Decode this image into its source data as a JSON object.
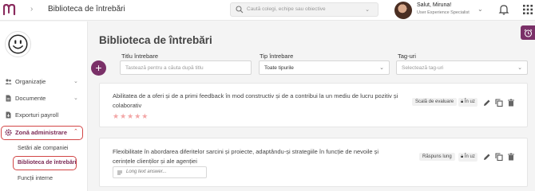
{
  "header": {
    "app_title": "Biblioteca de întrebări",
    "search_placeholder": "Caută colegi, echipe sau obiective",
    "user_name": "Salut, Miruna!",
    "user_role": "User Experience Specialist"
  },
  "sidebar": {
    "items": [
      {
        "label": "Organizație",
        "icon": "people-icon"
      },
      {
        "label": "Documente",
        "icon": "document-icon"
      },
      {
        "label": "Exporturi payroll",
        "icon": "export-icon"
      },
      {
        "label": "Zonă administrare",
        "icon": "gear-icon"
      }
    ],
    "subitems": [
      {
        "label": "Setări ale companiei"
      },
      {
        "label": "Biblioteca de întrebări"
      },
      {
        "label": "Funcții interne"
      }
    ]
  },
  "main": {
    "title": "Biblioteca de întrebări",
    "filters": {
      "title_label": "Titlu întrebare",
      "title_placeholder": "Tastează pentru a căuta după titlu",
      "type_label": "Tip întrebare",
      "type_value": "Toate tipurile",
      "tags_label": "Tag-uri",
      "tags_placeholder": "Selectează tag-uri"
    },
    "questions": [
      {
        "text": "Abilitatea de a oferi și de a primi feedback în mod constructiv și de a contribui la un mediu de lucru pozitiv și colaborativ",
        "type": "Scală de evaluare",
        "status": "În uz",
        "rating_stars": 5
      },
      {
        "text": "Flexibilitate în abordarea diferitelor sarcini și proiecte, adaptându-și strategiile în funcție de nevoile și cerințele clienților și ale agenției",
        "type": "Răspuns lung",
        "status": "În uz",
        "answer_placeholder": "Long text answer..."
      }
    ]
  },
  "colors": {
    "brand": "#7a3068",
    "active_border": "#d24545",
    "star": "#f3a6a6"
  }
}
